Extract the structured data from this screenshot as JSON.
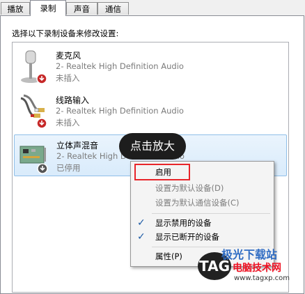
{
  "tabs": [
    {
      "label": "播放"
    },
    {
      "label": "录制",
      "active": true
    },
    {
      "label": "声音"
    },
    {
      "label": "通信"
    }
  ],
  "instruction": "选择以下录制设备来修改设置:",
  "devices": [
    {
      "name": "麦克风",
      "driver": "2- Realtek High Definition Audio",
      "status": "未插入",
      "icon": "microphone-icon"
    },
    {
      "name": "线路输入",
      "driver": "2- Realtek High Definition Audio",
      "status": "未插入",
      "icon": "line-in-cable-icon"
    },
    {
      "name": "立体声混音",
      "driver": "2- Realtek High Definition Audio",
      "status": "已停用",
      "icon": "sound-card-icon"
    }
  ],
  "bubble": "点击放大",
  "menu": {
    "enable": "启用",
    "set_default": "设置为默认设备(D)",
    "set_default_comm": "设置为默认通信设备(C)",
    "show_disabled": "显示禁用的设备",
    "show_disconnected": "显示已断开的设备",
    "properties": "属性(P)"
  },
  "watermark": {
    "line1": "极光下载站",
    "line2": "电脑技术网",
    "line3": "www.tagxp.com",
    "logo": "TAG"
  },
  "colors": {
    "accent": "#1c5aa5",
    "highlight": "#e8252a",
    "selection": "#d9ebfb"
  }
}
